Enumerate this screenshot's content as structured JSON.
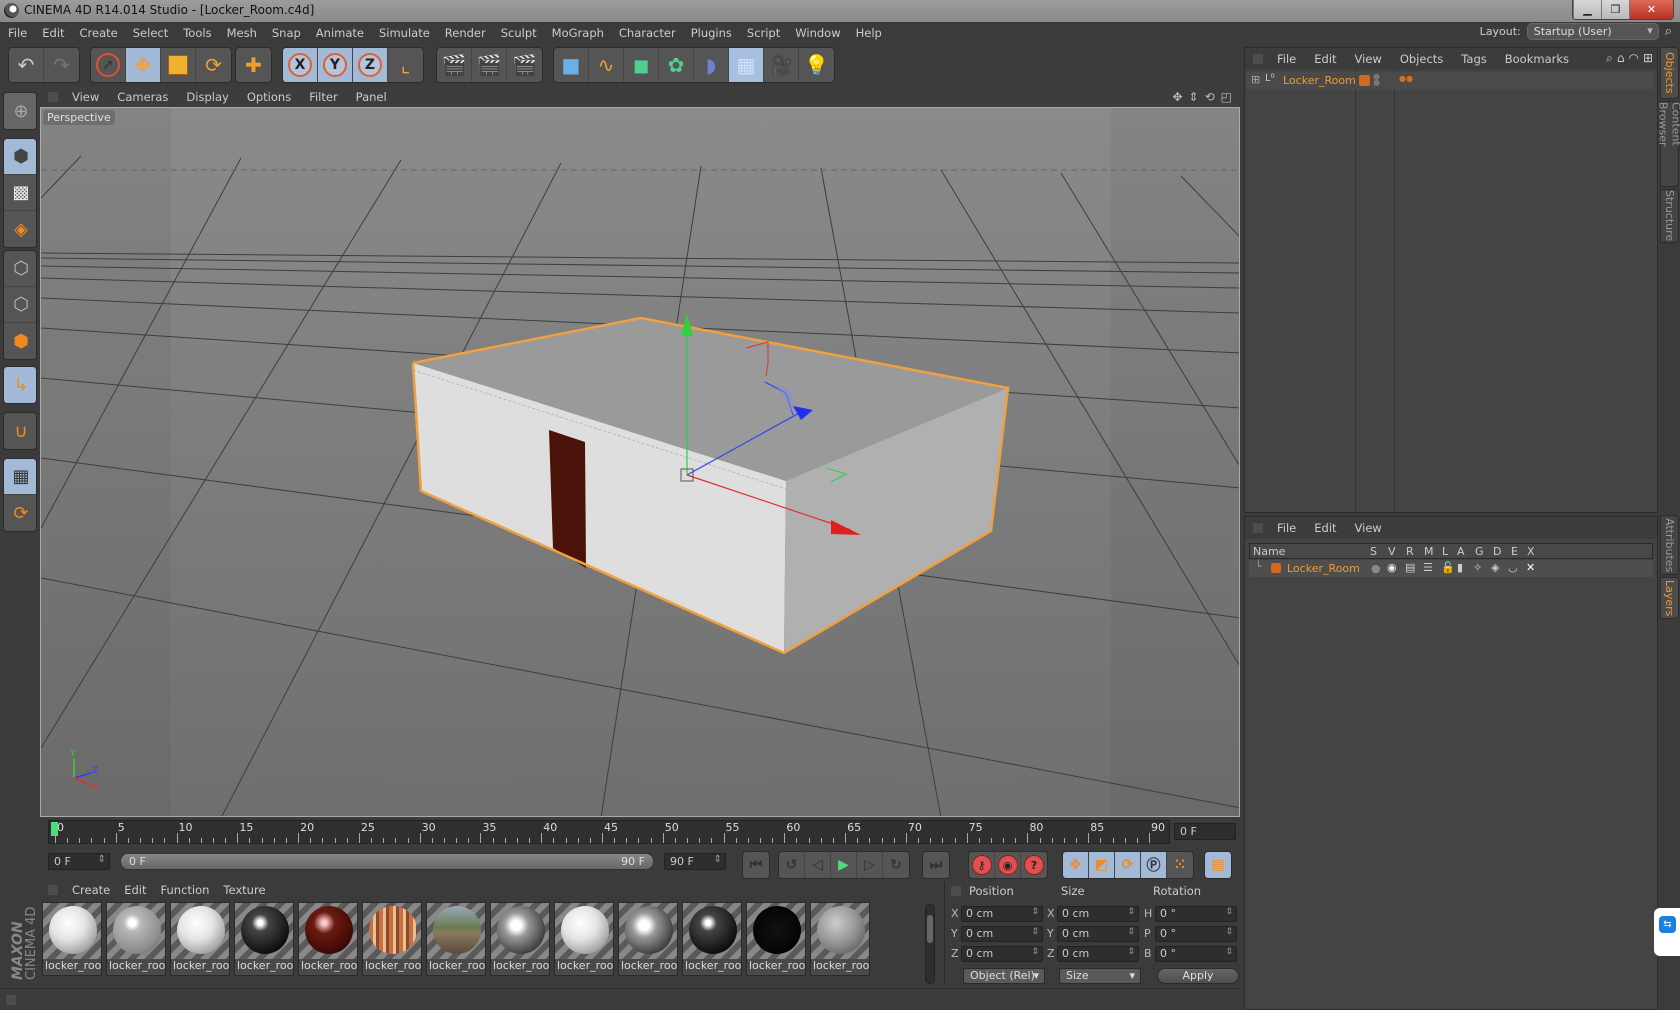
{
  "window": {
    "title": "CINEMA 4D R14.014 Studio - [Locker_Room.c4d]",
    "controls": [
      "minimize",
      "restore",
      "close"
    ]
  },
  "menubar": [
    "File",
    "Edit",
    "Create",
    "Select",
    "Tools",
    "Mesh",
    "Snap",
    "Animate",
    "Simulate",
    "Render",
    "Sculpt",
    "MoGraph",
    "Character",
    "Plugins",
    "Script",
    "Window",
    "Help"
  ],
  "layout": {
    "label": "Layout:",
    "value": "Startup (User)"
  },
  "toolbar": {
    "groups": [
      [
        "undo-icon",
        "redo-icon"
      ],
      [
        "live-selection-icon",
        "move-icon",
        "scale-icon",
        "rotate-icon"
      ],
      [
        "last-tool-icon"
      ],
      [
        "x-axis-lock-icon",
        "y-axis-lock-icon",
        "z-axis-lock-icon",
        "coordinate-system-icon"
      ],
      [
        "render-view-icon",
        "render-picture-viewer-icon",
        "render-settings-icon"
      ],
      [
        "cube-object-icon",
        "spline-pen-icon",
        "subdivision-surface-icon",
        "array-icon",
        "deformer-icon",
        "floor-icon",
        "camera-icon",
        "light-icon"
      ]
    ],
    "axis_labels": [
      "X",
      "Y",
      "Z"
    ]
  },
  "left_toolbar": [
    "make-editable-icon",
    "model-mode-icon",
    "texture-mode-icon",
    "workplane-mode-icon",
    "points-mode-icon",
    "edges-mode-icon",
    "polygons-mode-icon",
    "axis-mode-icon",
    "snapping-icon",
    "locked-workplane-icon",
    "workplane-align-icon"
  ],
  "viewport": {
    "menu": [
      "View",
      "Cameras",
      "Display",
      "Options",
      "Filter",
      "Panel"
    ],
    "label": "Perspective",
    "nav_icons": [
      "pan-icon",
      "dolly-icon",
      "orbit-icon",
      "maximize-view-icon"
    ],
    "axis_gizmo": [
      "Y",
      "Z",
      "X"
    ]
  },
  "timeline": {
    "ticks": [
      0,
      5,
      10,
      15,
      20,
      25,
      30,
      35,
      40,
      45,
      50,
      55,
      60,
      65,
      70,
      75,
      80,
      85,
      90
    ],
    "current_frame": "0 F",
    "start_field": "0 F",
    "range_start": "0 F",
    "range_end": "90 F",
    "end_field": "90 F",
    "max_frame": 90
  },
  "transport": {
    "playback": [
      "go-to-start-icon",
      "previous-key-icon",
      "previous-frame-icon",
      "play-icon",
      "next-frame-icon",
      "next-key-icon",
      "go-to-end-icon"
    ],
    "record": [
      "record-key-icon",
      "autokey-icon",
      "keyframe-selection-icon"
    ],
    "key_modes": [
      "key-position-icon",
      "key-scale-icon",
      "key-rotation-icon",
      "key-parameter-icon",
      "key-point-level-icon"
    ],
    "timeline_icon": "timeline-window-icon"
  },
  "materials": {
    "menu": [
      "Create",
      "Edit",
      "Function",
      "Texture"
    ],
    "items": [
      {
        "name": "locker_roo",
        "style": "white"
      },
      {
        "name": "locker_roo",
        "style": "gray-glossy"
      },
      {
        "name": "locker_roo",
        "style": "white"
      },
      {
        "name": "locker_roo",
        "style": "black-glossy"
      },
      {
        "name": "locker_roo",
        "style": "dark-red"
      },
      {
        "name": "locker_roo",
        "style": "striped"
      },
      {
        "name": "locker_roo",
        "style": "env-reflect"
      },
      {
        "name": "locker_roo",
        "style": "chrome"
      },
      {
        "name": "locker_roo",
        "style": "white"
      },
      {
        "name": "locker_roo",
        "style": "chrome"
      },
      {
        "name": "locker_roo",
        "style": "black-glossy"
      },
      {
        "name": "locker_roo",
        "style": "black-photo"
      },
      {
        "name": "locker_roo",
        "style": "gray"
      }
    ]
  },
  "brand": {
    "maxon": "MAXON",
    "product": "CINEMA 4D"
  },
  "coordinates": {
    "headers": [
      "Position",
      "Size",
      "Rotation"
    ],
    "rows": [
      {
        "pos_axis": "X",
        "pos": "0 cm",
        "size_axis": "X",
        "size": "0 cm",
        "rot_axis": "H",
        "rot": "0 °"
      },
      {
        "pos_axis": "Y",
        "pos": "0 cm",
        "size_axis": "Y",
        "size": "0 cm",
        "rot_axis": "P",
        "rot": "0 °"
      },
      {
        "pos_axis": "Z",
        "pos": "0 cm",
        "size_axis": "Z",
        "size": "0 cm",
        "rot_axis": "B",
        "rot": "0 °"
      }
    ],
    "mode": "Object (Rel)",
    "size_mode": "Size",
    "apply": "Apply"
  },
  "objects_panel": {
    "menu": [
      "File",
      "Edit",
      "View",
      "Objects",
      "Tags",
      "Bookmarks"
    ],
    "objects": [
      {
        "name": "Locker_Room",
        "color": "#d2691e"
      }
    ]
  },
  "layers_panel": {
    "menu": [
      "File",
      "Edit",
      "View"
    ],
    "columns": [
      "Name",
      "S",
      "V",
      "R",
      "M",
      "L",
      "A",
      "G",
      "D",
      "E",
      "X"
    ],
    "layers": [
      {
        "name": "Locker_Room",
        "color": "#d2691e"
      }
    ]
  },
  "side_tabs": {
    "top": [
      {
        "label": "Objects",
        "active": true
      },
      {
        "label": "Content Browser",
        "active": false
      },
      {
        "label": "Structure",
        "active": false
      }
    ],
    "bottom": [
      {
        "label": "Attributes",
        "active": false
      },
      {
        "label": "Layers",
        "active": true
      }
    ]
  },
  "colors": {
    "accent": "#f09a30",
    "selection": "#f0a040",
    "active_button": "#a3b9d8",
    "play": "#4fdc80"
  }
}
